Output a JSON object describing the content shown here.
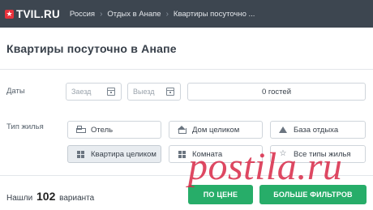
{
  "header": {
    "logo_text": "TVIL.RU",
    "logo_icon": "star-icon",
    "breadcrumbs": [
      "Россия",
      "Отдых в Анапе",
      "Квартиры посуточно ..."
    ]
  },
  "page": {
    "title": "Квартиры посуточно в Анапе"
  },
  "dates": {
    "label": "Даты",
    "checkin_placeholder": "Заезд",
    "checkout_placeholder": "Выезд",
    "guests_value": "0 гостей"
  },
  "housing": {
    "label": "Тип жилья",
    "options": [
      {
        "label": "Отель",
        "icon": "bed-icon",
        "active": false
      },
      {
        "label": "Дом целиком",
        "icon": "house-icon",
        "active": false
      },
      {
        "label": "База отдыха",
        "icon": "tent-icon",
        "active": false
      },
      {
        "label": "Квартира целиком",
        "icon": "grid-icon",
        "active": true
      },
      {
        "label": "Комната",
        "icon": "grid-icon",
        "active": false
      },
      {
        "label": "Все типы жилья",
        "icon": "star-outline-icon",
        "active": false
      }
    ]
  },
  "results": {
    "prefix": "Нашли",
    "count": "102",
    "suffix": "варианта"
  },
  "actions": {
    "sort_label": "ПО ЦЕНЕ",
    "filters_label": "БОЛЬШЕ ФИЛЬТРОВ"
  },
  "watermark": "postila.ru",
  "colors": {
    "topbar": "#3d4650",
    "accent_green": "#27ad69",
    "logo_red": "#e8323c",
    "watermark": "#d82846"
  }
}
